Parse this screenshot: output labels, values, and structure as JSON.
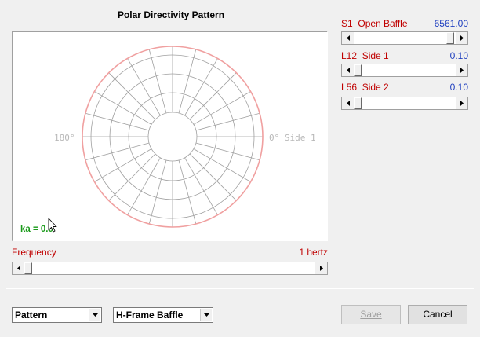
{
  "plot": {
    "title": "Polar Directivity Pattern",
    "label_left": "180°",
    "label_right": "0° Side 1",
    "ka_label": "ka = 0.0",
    "ring_color": "#f0a0a0",
    "grid_color": "#a0a0a0",
    "label_color": "#b8b8b8",
    "ka_color": "#1a9a1a"
  },
  "sliders": [
    {
      "id": "S1",
      "name": "Open Baffle",
      "value": "6561.00",
      "position": 0.98
    },
    {
      "id": "L12",
      "name": "Side 1",
      "value": "0.10",
      "position": 0.0
    },
    {
      "id": "L56",
      "name": "Side 2",
      "value": "0.10",
      "position": 0.0
    }
  ],
  "frequency": {
    "label": "Frequency",
    "value": "1 hertz",
    "position": 0.0
  },
  "view_combo": {
    "selected": "Pattern"
  },
  "type_combo": {
    "selected": "H-Frame Baffle"
  },
  "buttons": {
    "save": "Save",
    "cancel": "Cancel"
  },
  "colors": {
    "label_red": "#c00000",
    "value_blue": "#1f3fbf"
  }
}
